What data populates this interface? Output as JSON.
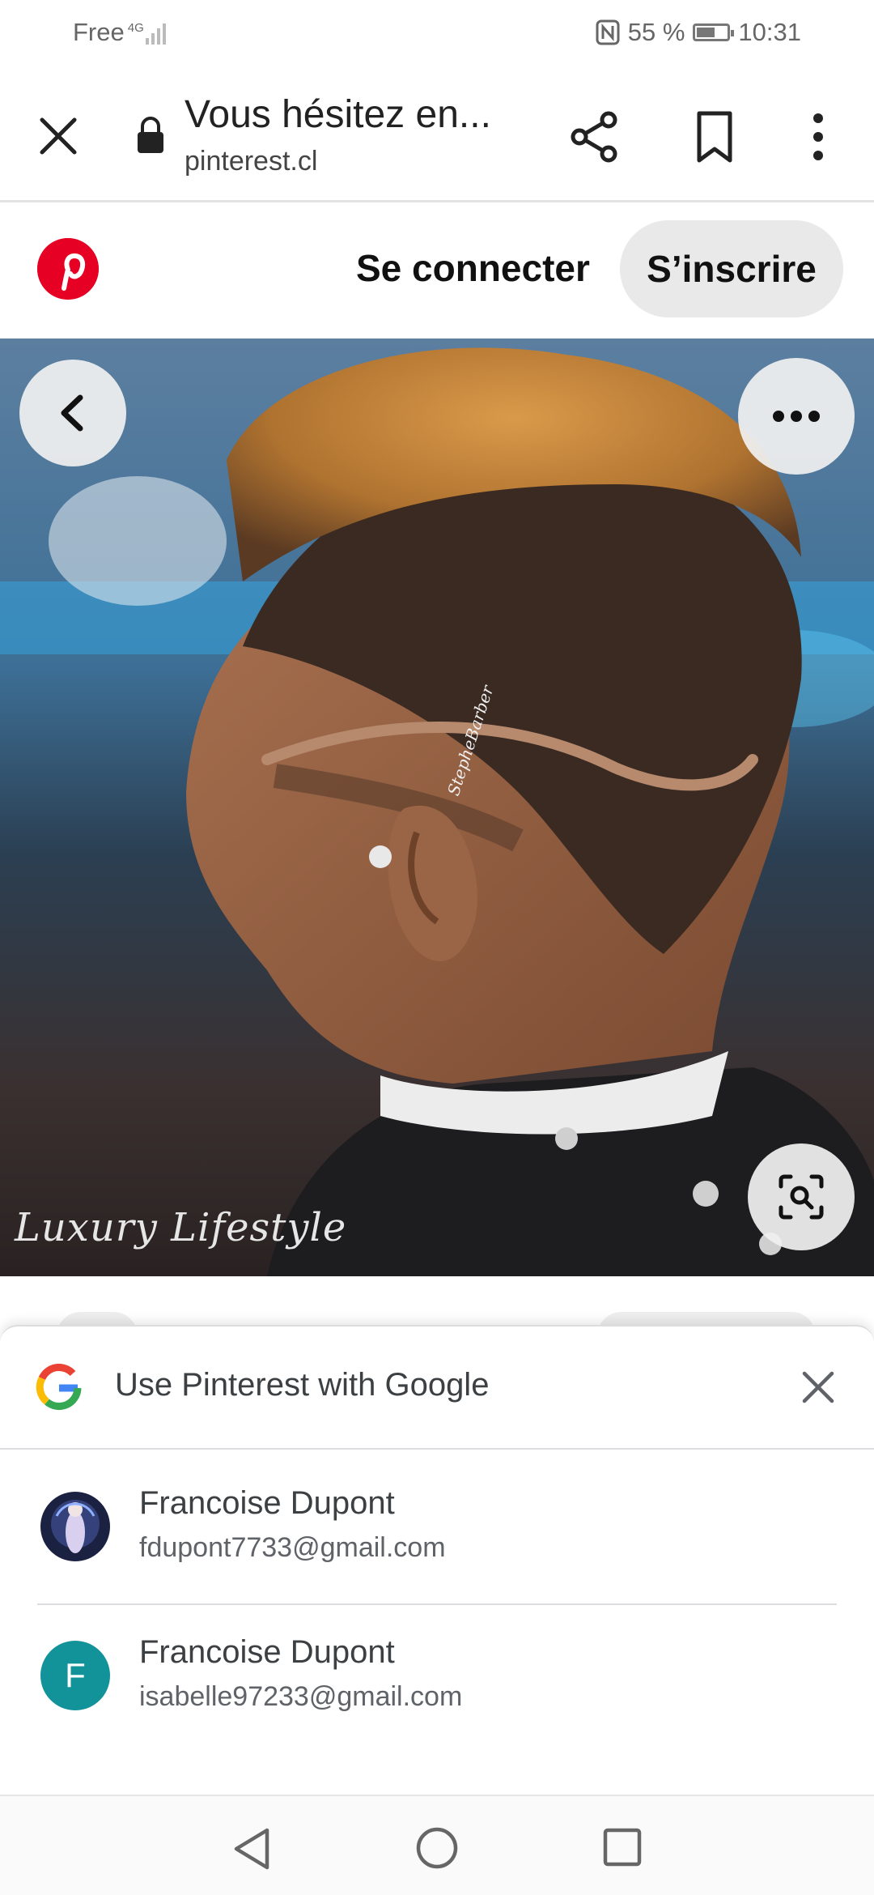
{
  "status_bar": {
    "carrier": "Free",
    "network_type": "4G",
    "battery_percent": "55 %",
    "time": "10:31",
    "icons": [
      "signal-icon",
      "nfc-icon",
      "battery-icon"
    ]
  },
  "browser": {
    "page_title": "Vous hésitez en...",
    "domain": "pinterest.cl",
    "icons": [
      "close-icon",
      "lock-icon",
      "share-icon",
      "bookmark-icon",
      "more-vertical-icon"
    ]
  },
  "pinterest": {
    "login_label": "Se connecter",
    "signup_label": "S’inscrire",
    "logo_letter": "P"
  },
  "pin": {
    "watermark": "Luxury Lifestyle",
    "ear_signature": "StepheBarber",
    "icons": [
      "back-arrow-icon",
      "more-horizontal-icon",
      "visual-search-icon"
    ]
  },
  "google_sheet": {
    "title": "Use Pinterest with Google",
    "accounts": [
      {
        "name": "Francoise Dupont",
        "email": "fdupont7733@gmail.com",
        "avatar": "photo"
      },
      {
        "name": "Francoise Dupont",
        "email": "isabelle97233@gmail.com",
        "avatar_initial": "F",
        "avatar_color": "#12939a"
      }
    ]
  },
  "colors": {
    "pinterest_red": "#e60023",
    "signup_bg": "#e9e9e9",
    "google_text": "#3c4043"
  }
}
